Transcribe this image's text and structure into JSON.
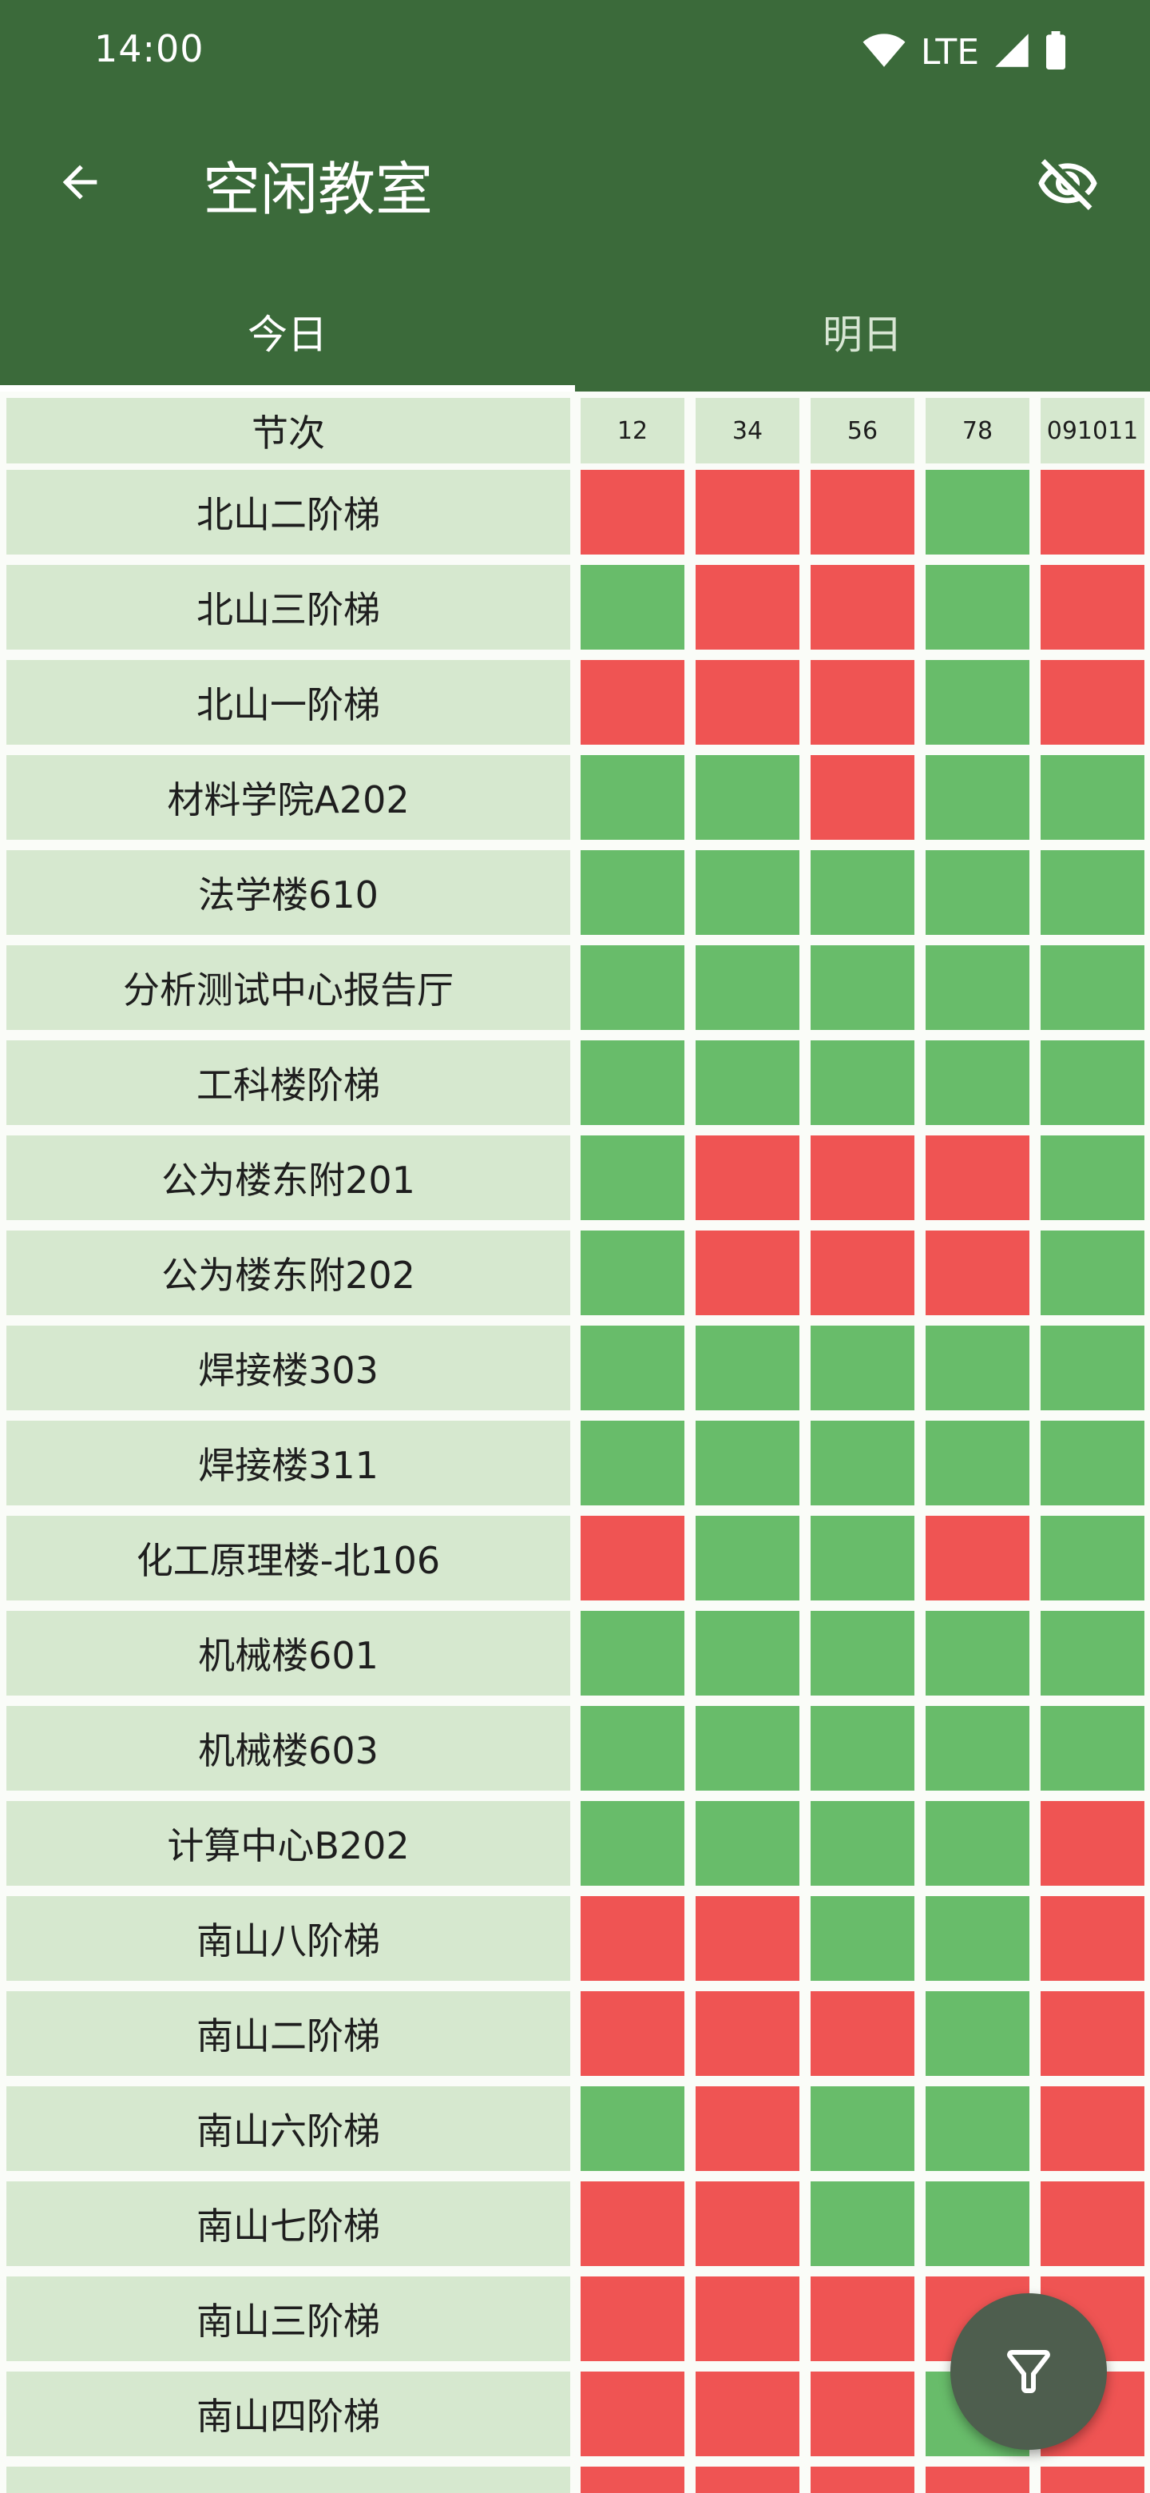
{
  "status_bar": {
    "time": "14:00",
    "network": "LTE"
  },
  "toolbar": {
    "title": "空闲教室"
  },
  "tabs": [
    {
      "label": "今日",
      "active": true
    },
    {
      "label": "明日",
      "active": false
    }
  ],
  "grid": {
    "header": {
      "label": "节次",
      "periods": [
        "12",
        "34",
        "56",
        "78",
        "091011"
      ]
    },
    "legend_colors": {
      "free": "#68bc6a",
      "busy": "#ef5453",
      "name_bg": "#d6e8cf"
    },
    "rows": [
      {
        "name": "北山二阶梯",
        "status": [
          "busy",
          "busy",
          "busy",
          "free",
          "busy"
        ]
      },
      {
        "name": "北山三阶梯",
        "status": [
          "free",
          "busy",
          "busy",
          "free",
          "busy"
        ]
      },
      {
        "name": "北山一阶梯",
        "status": [
          "busy",
          "busy",
          "busy",
          "free",
          "busy"
        ]
      },
      {
        "name": "材料学院A202",
        "status": [
          "free",
          "free",
          "busy",
          "free",
          "free"
        ]
      },
      {
        "name": "法学楼610",
        "status": [
          "free",
          "free",
          "free",
          "free",
          "free"
        ]
      },
      {
        "name": "分析测试中心报告厅",
        "status": [
          "free",
          "free",
          "free",
          "free",
          "free"
        ]
      },
      {
        "name": "工科楼阶梯",
        "status": [
          "free",
          "free",
          "free",
          "free",
          "free"
        ]
      },
      {
        "name": "公为楼东附201",
        "status": [
          "free",
          "busy",
          "busy",
          "busy",
          "free"
        ]
      },
      {
        "name": "公为楼东附202",
        "status": [
          "free",
          "busy",
          "busy",
          "busy",
          "free"
        ]
      },
      {
        "name": "焊接楼303",
        "status": [
          "free",
          "free",
          "free",
          "free",
          "free"
        ]
      },
      {
        "name": "焊接楼311",
        "status": [
          "free",
          "free",
          "free",
          "free",
          "free"
        ]
      },
      {
        "name": "化工原理楼-北106",
        "status": [
          "busy",
          "free",
          "free",
          "busy",
          "free"
        ]
      },
      {
        "name": "机械楼601",
        "status": [
          "free",
          "free",
          "free",
          "free",
          "free"
        ]
      },
      {
        "name": "机械楼603",
        "status": [
          "free",
          "free",
          "free",
          "free",
          "free"
        ]
      },
      {
        "name": "计算中心B202",
        "status": [
          "free",
          "free",
          "free",
          "free",
          "busy"
        ]
      },
      {
        "name": "南山八阶梯",
        "status": [
          "busy",
          "busy",
          "free",
          "free",
          "busy"
        ]
      },
      {
        "name": "南山二阶梯",
        "status": [
          "busy",
          "busy",
          "busy",
          "free",
          "busy"
        ]
      },
      {
        "name": "南山六阶梯",
        "status": [
          "free",
          "busy",
          "free",
          "free",
          "busy"
        ]
      },
      {
        "name": "南山七阶梯",
        "status": [
          "busy",
          "busy",
          "free",
          "free",
          "busy"
        ]
      },
      {
        "name": "南山三阶梯",
        "status": [
          "busy",
          "busy",
          "busy",
          "busy",
          "busy"
        ]
      },
      {
        "name": "南山四阶梯",
        "status": [
          "busy",
          "busy",
          "busy",
          "free",
          "busy"
        ]
      },
      {
        "name": "",
        "status": [
          "busy",
          "busy",
          "busy",
          "busy",
          "busy"
        ]
      }
    ]
  },
  "fab": {
    "icon": "filter-icon"
  }
}
